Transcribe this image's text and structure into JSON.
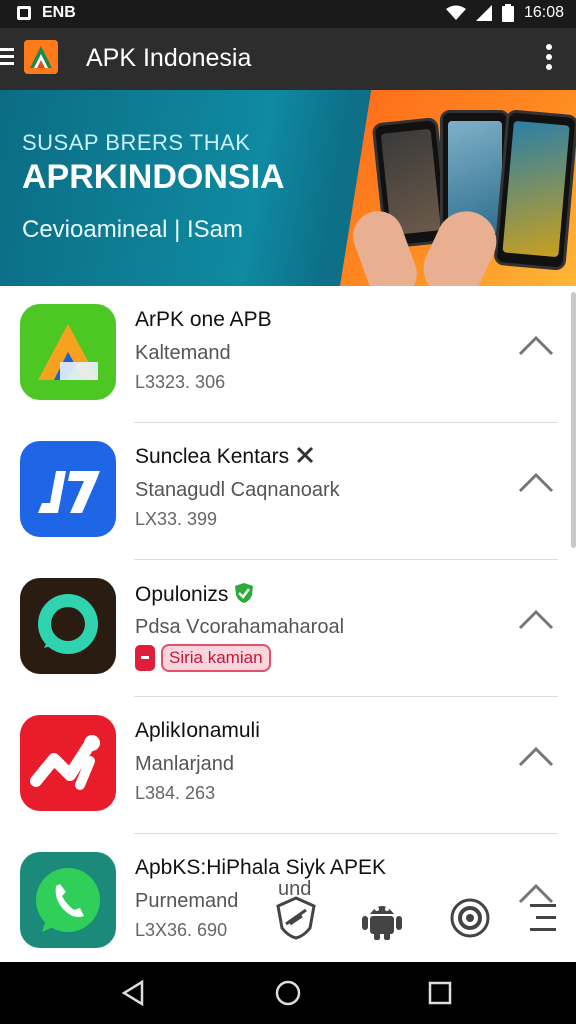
{
  "status_bar": {
    "left_text": "ENB",
    "time": "16:08",
    "icons": [
      "notification-icon",
      "wifi-icon",
      "signal-icon",
      "battery-icon"
    ]
  },
  "app_bar": {
    "title": "APK Indonesia",
    "icons": [
      "menu-icon",
      "app-logo-icon",
      "overflow-menu-icon"
    ]
  },
  "banner": {
    "line1": "SUSAP BRERS THAK",
    "line2": "APRKINDONSIA",
    "line3": "Cevioamineal | ISam"
  },
  "apps": [
    {
      "name": "ArPK one APB",
      "subtitle": "Kaltemand",
      "meta": "L3323. 306",
      "icon": "triangle-a-icon",
      "color": "#49c21e"
    },
    {
      "name": "Sunclea Kentars",
      "subtitle": "Stanagudl Caqnanoark",
      "meta": "LX33. 399",
      "icon": "j7-icon",
      "color": "#1e66e6"
    },
    {
      "name": "Opulonizs",
      "subtitle": "Pdsa Vcorahamaharoal",
      "tag": "Siria kamian",
      "icon": "chat-bubble-icon",
      "color": "#2a1c10"
    },
    {
      "name": "AplikIonamuli",
      "subtitle": "Manlarjand",
      "meta": "L384. 263",
      "icon": "chart-squiggle-icon",
      "color": "#e81c2a"
    },
    {
      "name": "ApbKS:HiPhala Siyk APEK",
      "subtitle": "Purnemand",
      "meta": "L3X36. 690",
      "icon": "phone-bubble-icon",
      "color": "#1b8a7a"
    }
  ],
  "floating_actions": [
    "shield-feather-icon",
    "android-icon",
    "target-icon",
    "list-icon"
  ],
  "floating_caption": "und",
  "nav_bar": [
    "back-icon",
    "home-icon",
    "recents-icon"
  ]
}
